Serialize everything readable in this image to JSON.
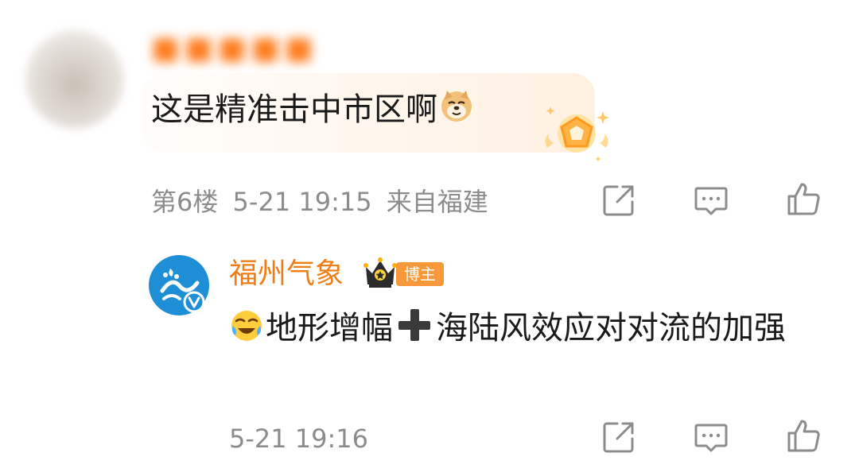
{
  "comment": {
    "username": "■■■■■",
    "text": "这是精准击中市区啊",
    "emoji": "doge-emoji",
    "floor": "第6楼",
    "datetime": "5-21 19:15",
    "location": "来自福建",
    "actions": [
      "share-icon",
      "comment-icon",
      "like-icon"
    ]
  },
  "reply": {
    "username": "福州气象",
    "role_tag": "博主",
    "text": "地形增幅",
    "text_rest": "海陆风效应对对流的加强",
    "emoji_lead": "crying-laugh-emoji",
    "emoji_mid": "heavy-plus-emoji",
    "datetime": "5-21 19:16",
    "actions": [
      "share-icon",
      "comment-icon",
      "like-icon"
    ]
  },
  "colors": {
    "username_orange": "#f07d14",
    "meta_gray": "#8c8c8c",
    "tag_orange": "#f7993b",
    "avatar_blue": "#1e8fd6"
  }
}
